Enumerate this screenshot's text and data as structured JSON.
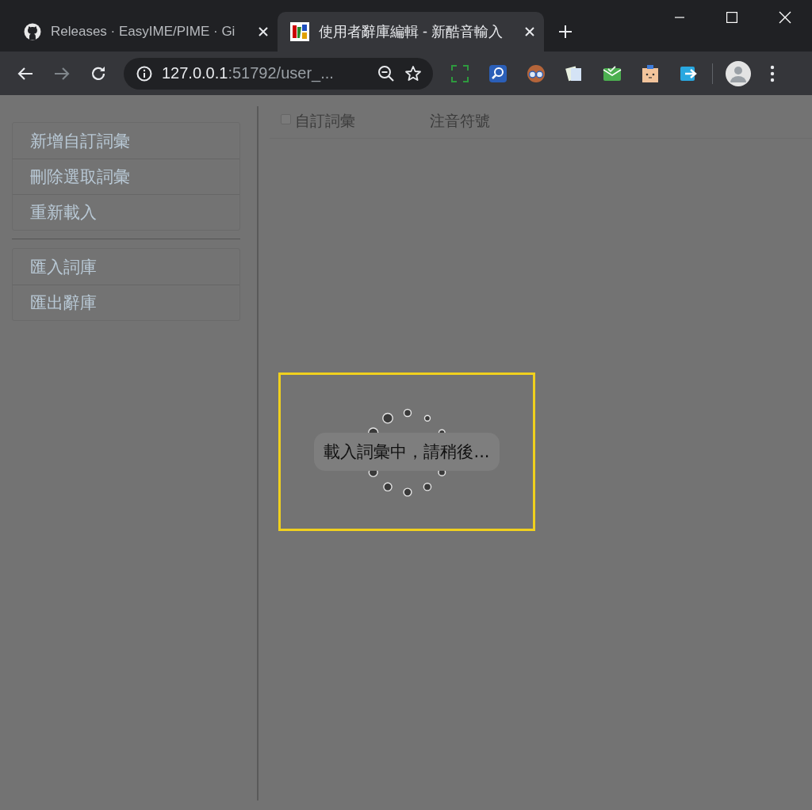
{
  "browser": {
    "tabs": [
      {
        "title": "Releases · EasyIME/PIME · Gi",
        "selected": false
      },
      {
        "title": "使用者辭庫編輯 - 新酷音輸入",
        "selected": true
      }
    ],
    "address": {
      "host": "127.0.0.1",
      "rest": ":51792/user_..."
    }
  },
  "sidebar": {
    "groups": [
      [
        "新增自訂詞彙",
        "刪除選取詞彙",
        "重新載入"
      ],
      [
        "匯入詞庫",
        "匯出辭庫"
      ]
    ]
  },
  "table": {
    "select_all": {
      "checked": false
    },
    "columns": [
      "自訂詞彙",
      "注音符號"
    ]
  },
  "loading": {
    "message": "載入詞彙中，請稍後..."
  }
}
